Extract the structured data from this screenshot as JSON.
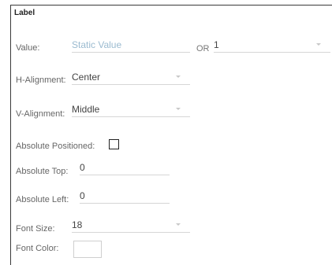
{
  "panel": {
    "title": "Label"
  },
  "value_row": {
    "label": "Value:",
    "static_placeholder": "Static Value",
    "or_label": "OR",
    "select_value": "1"
  },
  "h_alignment": {
    "label": "H-Alignment:",
    "value": "Center"
  },
  "v_alignment": {
    "label": "V-Alignment:",
    "value": "Middle"
  },
  "absolute_positioned": {
    "label": "Absolute Positioned:",
    "checked": false
  },
  "absolute_top": {
    "label": "Absolute Top:",
    "value": "0"
  },
  "absolute_left": {
    "label": "Absolute Left:",
    "value": "0"
  },
  "font_size": {
    "label": "Font Size:",
    "value": "18"
  },
  "font_color": {
    "label": "Font Color:",
    "value": "#ffffff"
  }
}
